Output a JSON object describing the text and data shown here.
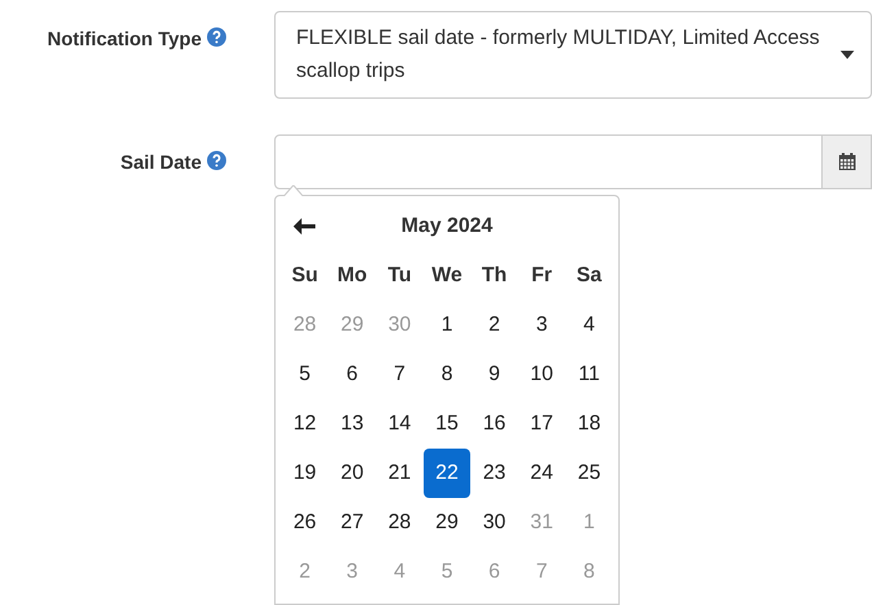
{
  "fields": [
    {
      "label": "Notification Type",
      "kind": "select",
      "value": "FLEXIBLE sail date - formerly MULTIDAY, Limited Access scallop trips"
    },
    {
      "label": "Sail Date",
      "kind": "date"
    }
  ],
  "calendar": {
    "title": "May 2024",
    "weekdays": [
      "Su",
      "Mo",
      "Tu",
      "We",
      "Th",
      "Fr",
      "Sa"
    ],
    "weeks": [
      [
        {
          "day": "28",
          "muted": true,
          "selected": false
        },
        {
          "day": "29",
          "muted": true,
          "selected": false
        },
        {
          "day": "30",
          "muted": true,
          "selected": false
        },
        {
          "day": "1",
          "muted": false,
          "selected": false
        },
        {
          "day": "2",
          "muted": false,
          "selected": false
        },
        {
          "day": "3",
          "muted": false,
          "selected": false
        },
        {
          "day": "4",
          "muted": false,
          "selected": false
        }
      ],
      [
        {
          "day": "5",
          "muted": false,
          "selected": false
        },
        {
          "day": "6",
          "muted": false,
          "selected": false
        },
        {
          "day": "7",
          "muted": false,
          "selected": false
        },
        {
          "day": "8",
          "muted": false,
          "selected": false
        },
        {
          "day": "9",
          "muted": false,
          "selected": false
        },
        {
          "day": "10",
          "muted": false,
          "selected": false
        },
        {
          "day": "11",
          "muted": false,
          "selected": false
        }
      ],
      [
        {
          "day": "12",
          "muted": false,
          "selected": false
        },
        {
          "day": "13",
          "muted": false,
          "selected": false
        },
        {
          "day": "14",
          "muted": false,
          "selected": false
        },
        {
          "day": "15",
          "muted": false,
          "selected": false
        },
        {
          "day": "16",
          "muted": false,
          "selected": false
        },
        {
          "day": "17",
          "muted": false,
          "selected": false
        },
        {
          "day": "18",
          "muted": false,
          "selected": false
        }
      ],
      [
        {
          "day": "19",
          "muted": false,
          "selected": false
        },
        {
          "day": "20",
          "muted": false,
          "selected": false
        },
        {
          "day": "21",
          "muted": false,
          "selected": false
        },
        {
          "day": "22",
          "muted": false,
          "selected": true
        },
        {
          "day": "23",
          "muted": false,
          "selected": false
        },
        {
          "day": "24",
          "muted": false,
          "selected": false
        },
        {
          "day": "25",
          "muted": false,
          "selected": false
        }
      ],
      [
        {
          "day": "26",
          "muted": false,
          "selected": false
        },
        {
          "day": "27",
          "muted": false,
          "selected": false
        },
        {
          "day": "28",
          "muted": false,
          "selected": false
        },
        {
          "day": "29",
          "muted": false,
          "selected": false
        },
        {
          "day": "30",
          "muted": false,
          "selected": false
        },
        {
          "day": "31",
          "muted": true,
          "selected": false
        },
        {
          "day": "1",
          "muted": true,
          "selected": false
        }
      ],
      [
        {
          "day": "2",
          "muted": true,
          "selected": false
        },
        {
          "day": "3",
          "muted": true,
          "selected": false
        },
        {
          "day": "4",
          "muted": true,
          "selected": false
        },
        {
          "day": "5",
          "muted": true,
          "selected": false
        },
        {
          "day": "6",
          "muted": true,
          "selected": false
        },
        {
          "day": "7",
          "muted": true,
          "selected": false
        },
        {
          "day": "8",
          "muted": true,
          "selected": false
        }
      ]
    ]
  }
}
